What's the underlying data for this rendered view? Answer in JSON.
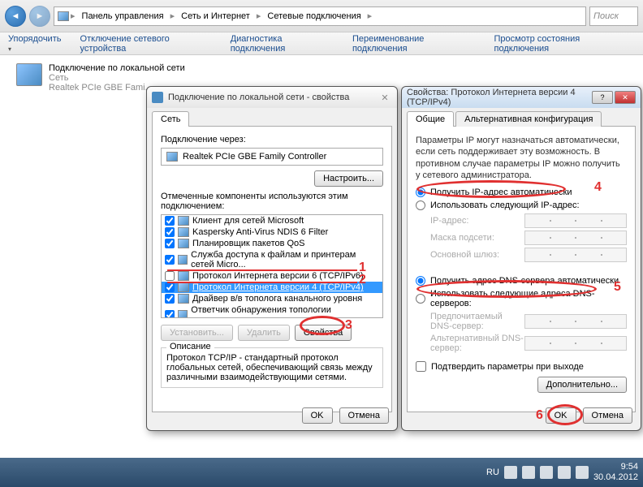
{
  "explorer": {
    "breadcrumb": [
      "Панель управления",
      "Сеть и Интернет",
      "Сетевые подключения"
    ],
    "search_placeholder": "Поиск",
    "toolbar": [
      "Упорядочить",
      "Отключение сетевого устройства",
      "Диагностика подключения",
      "Переименование подключения",
      "Просмотр состояния подключения"
    ],
    "connection": {
      "title": "Подключение по локальной сети",
      "status": "Сеть",
      "adapter": "Realtek PCIe GBE Fami..."
    }
  },
  "dlg1": {
    "title": "Подключение по локальной сети - свойства",
    "tab_net": "Сеть",
    "connect_via": "Подключение через:",
    "adapter": "Realtek PCIe GBE Family Controller",
    "configure": "Настроить...",
    "components_label": "Отмеченные компоненты используются этим подключением:",
    "components": [
      {
        "checked": true,
        "label": "Клиент для сетей Microsoft"
      },
      {
        "checked": true,
        "label": "Kaspersky Anti-Virus NDIS 6 Filter"
      },
      {
        "checked": true,
        "label": "Планировщик пакетов QoS"
      },
      {
        "checked": true,
        "label": "Служба доступа к файлам и принтерам сетей Micro..."
      },
      {
        "checked": false,
        "label": "Протокол Интернета версии 6 (TCP/IPv6)"
      },
      {
        "checked": true,
        "label": "Протокол Интернета версии 4 (TCP/IPv4)",
        "selected": true
      },
      {
        "checked": true,
        "label": "Драйвер в/в тополога канального уровня"
      },
      {
        "checked": true,
        "label": "Ответчик обнаружения топологии канального уровня"
      }
    ],
    "install": "Установить...",
    "remove": "Удалить",
    "properties": "Свойства",
    "desc_title": "Описание",
    "desc": "Протокол TCP/IP - стандартный протокол глобальных сетей, обеспечивающий связь между различными взаимодействующими сетями.",
    "ok": "OK",
    "cancel": "Отмена"
  },
  "dlg2": {
    "title": "Свойства: Протокол Интернета версии 4 (TCP/IPv4)",
    "tab_general": "Общие",
    "tab_alt": "Альтернативная конфигурация",
    "info": "Параметры IP могут назначаться автоматически, если сеть поддерживает эту возможность. В противном случае параметры IP можно получить у сетевого администратора.",
    "ip_auto": "Получить IP-адрес автоматически",
    "ip_manual": "Использовать следующий IP-адрес:",
    "ip_addr": "IP-адрес:",
    "mask": "Маска подсети:",
    "gateway": "Основной шлюз:",
    "dns_auto": "Получить адрес DNS-сервера автоматически",
    "dns_manual": "Использовать следующие адреса DNS-серверов:",
    "dns_pref": "Предпочитаемый DNS-сервер:",
    "dns_alt": "Альтернативный DNS-сервер:",
    "validate": "Подтвердить параметры при выходе",
    "advanced": "Дополнительно...",
    "ok": "OK",
    "cancel": "Отмена"
  },
  "taskbar": {
    "lang": "RU",
    "time": "9:54",
    "date": "30.04.2012"
  },
  "annotations": {
    "n1": "1",
    "n2": "2",
    "n3": "3",
    "n4": "4",
    "n5": "5",
    "n6": "6"
  }
}
